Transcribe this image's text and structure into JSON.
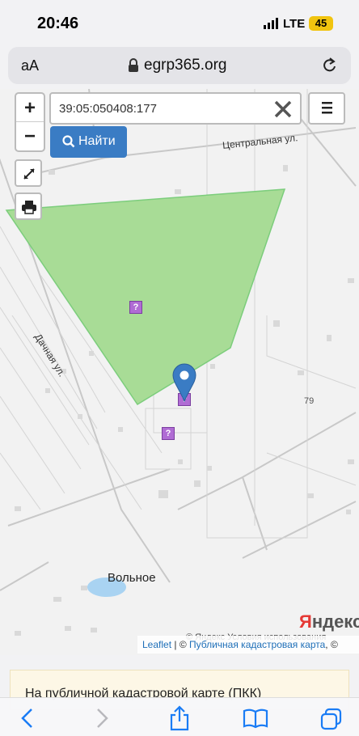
{
  "status_bar": {
    "time": "20:46",
    "network": "LTE",
    "battery": "45"
  },
  "url_bar": {
    "text_size_label": "аА",
    "domain": "egrp365.org"
  },
  "map": {
    "zoom_in_label": "+",
    "zoom_out_label": "−",
    "search_value": "39:05:050408:177",
    "find_button_label": "Найти",
    "streets": {
      "central": "Центральная ул.",
      "dachnaya": "Дачная ул."
    },
    "village_label": "Вольное",
    "number_label": "79",
    "yandex_logo": {
      "first": "Я",
      "rest": "ндекс"
    },
    "yandex_attribution": "© Яндекс  Условия использования",
    "attribution": {
      "leaflet": "Leaflet",
      "sep1": " | © ",
      "pkk": "Публичная кадастровая карта",
      "sep2": ", ©"
    },
    "unknown_marker_label": "?",
    "colors": {
      "parcel_fill": "#a8dc96",
      "marker": "#3a7cc4",
      "unknown_marker": "#b06cd4"
    }
  },
  "info_text": "На публичной кадастровой карте (ПКК)",
  "toolbar": {
    "icons": [
      "back-icon",
      "forward-icon",
      "share-icon",
      "bookmarks-icon",
      "tabs-icon"
    ]
  }
}
